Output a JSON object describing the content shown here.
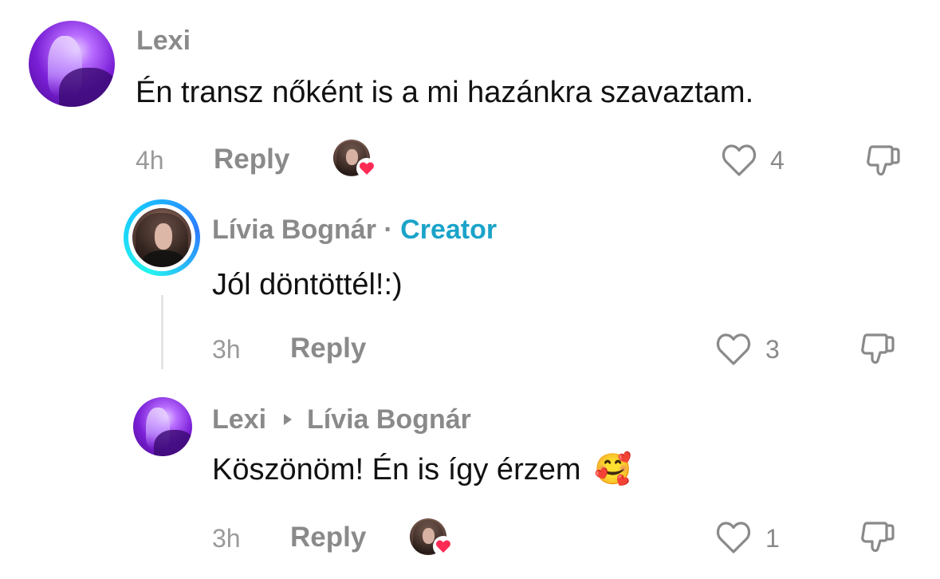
{
  "comments": [
    {
      "author": "Lexi",
      "text": "Én transz nőként is a mi hazánkra szavaztam.",
      "time": "4h",
      "reply_label": "Reply",
      "likes": "4",
      "creator_liked": true
    },
    {
      "author": "Lívia Bognár",
      "separator": "·",
      "badge": "Creator",
      "text": "Jól döntöttél!:)",
      "time": "3h",
      "reply_label": "Reply",
      "likes": "3"
    },
    {
      "author": "Lexi",
      "reply_to": "Lívia Bognár",
      "text": "Köszönöm! Én is így érzem",
      "emoji": "🥰",
      "time": "3h",
      "reply_label": "Reply",
      "likes": "1",
      "creator_liked": true
    }
  ],
  "colors": {
    "creator_badge": "#1ba3c9",
    "heart_badge": "#fe2c55",
    "name_gray": "#8a8a8a"
  },
  "icons": [
    "heart-outline-icon",
    "thumbs-down-icon",
    "creator-heart-badge-icon",
    "reply-arrow-icon"
  ]
}
